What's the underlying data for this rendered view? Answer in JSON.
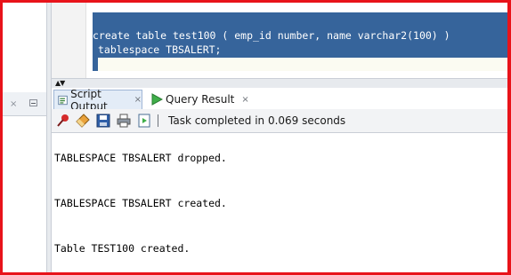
{
  "editor": {
    "lines": [
      "create table test100 ( emp_id number, name varchar2(100) )",
      "tablespace TBSALERT;"
    ]
  },
  "left_panel": {
    "close_glyph": "×"
  },
  "results": {
    "tabs": [
      {
        "label": "Script Output",
        "close": "×",
        "icon": "script-output-icon"
      },
      {
        "label": "Query Result",
        "close": "×",
        "icon": "run-arrow-icon"
      }
    ]
  },
  "toolbar": {
    "icons": [
      "pin-icon",
      "eraser-icon",
      "save-icon",
      "print-icon",
      "open-file-icon"
    ],
    "status": "Task completed in 0.069 seconds"
  },
  "output": {
    "lines": [
      "TABLESPACE TBSALERT dropped.",
      "TABLESPACE TBSALERT created.",
      "Table TEST100 created."
    ]
  },
  "colors": {
    "frame": "#e8131a",
    "selection": "#36649b",
    "tab_active": "#e3ecf7"
  }
}
